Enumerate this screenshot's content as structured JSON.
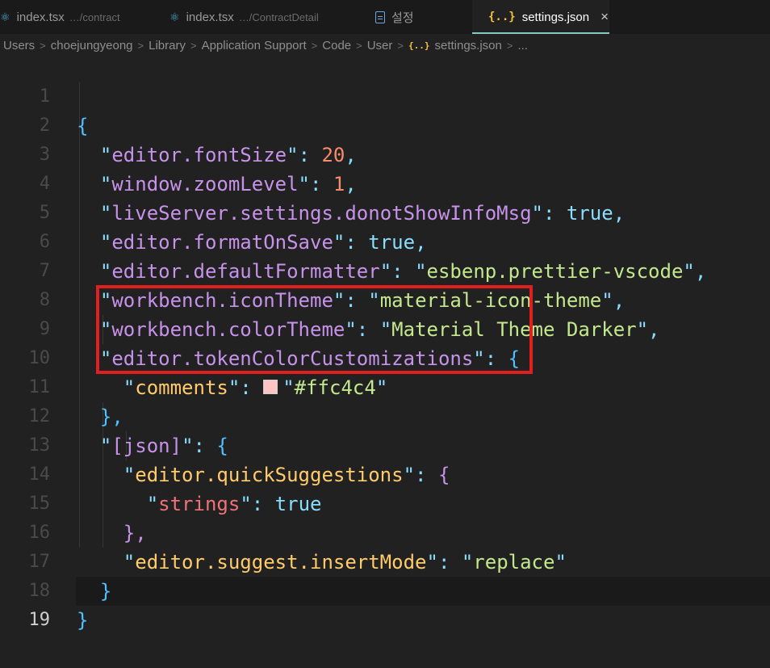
{
  "tabs": [
    {
      "label": "index.tsx",
      "desc": "…/contract",
      "icon": "react-icon"
    },
    {
      "label": "index.tsx",
      "desc": "…/ContractDetail",
      "icon": "react-icon"
    },
    {
      "label": "설정",
      "desc": "",
      "icon": "file-icon"
    },
    {
      "label": "settings.json",
      "desc": "",
      "icon": "json-icon",
      "active": true,
      "close": "×"
    }
  ],
  "breadcrumb": [
    "Users",
    "choejungyeong",
    "Library",
    "Application Support",
    "Code",
    "User",
    "settings.json",
    "..."
  ],
  "breadcrumb_sep": ">",
  "json_icon_glyph": "{..}",
  "lines": [
    {
      "n": "1",
      "t": "{"
    },
    {
      "n": "2",
      "key": "editor.fontSize",
      "val": "20"
    },
    {
      "n": "3",
      "key": "window.zoomLevel",
      "val": "1"
    },
    {
      "n": "4",
      "key": "liveServer.settings.donotShowInfoMsg",
      "val": "true"
    },
    {
      "n": "5",
      "key": "editor.formatOnSave",
      "val": "true"
    },
    {
      "n": "6",
      "key": "editor.defaultFormatter",
      "val": "esbenp.prettier-vscode"
    },
    {
      "n": "7",
      "key": "workbench.iconTheme",
      "val": "material-icon-theme"
    },
    {
      "n": "8",
      "key": "workbench.colorTheme",
      "val": "Material Theme Darker"
    },
    {
      "n": "9",
      "key": "editor.tokenColorCustomizations",
      "val": "{"
    },
    {
      "n": "10",
      "key": "comments",
      "val": "#ffc4c4"
    },
    {
      "n": "11",
      "t": "},"
    },
    {
      "n": "12",
      "key": "[json]",
      "val": "{"
    },
    {
      "n": "13",
      "key": "editor.quickSuggestions",
      "val": "{"
    },
    {
      "n": "14",
      "key": "strings",
      "val": "true"
    },
    {
      "n": "15",
      "t": "},"
    },
    {
      "n": "16",
      "key": "editor.suggest.insertMode",
      "val": "replace"
    },
    {
      "n": "17",
      "t": "}"
    },
    {
      "n": "18",
      "t": "}"
    },
    {
      "n": "19",
      "t": ""
    }
  ],
  "colors": {
    "swatch": "#ffc4c4",
    "highlight_border": "#e0201f",
    "accent": "#80cbc4"
  }
}
